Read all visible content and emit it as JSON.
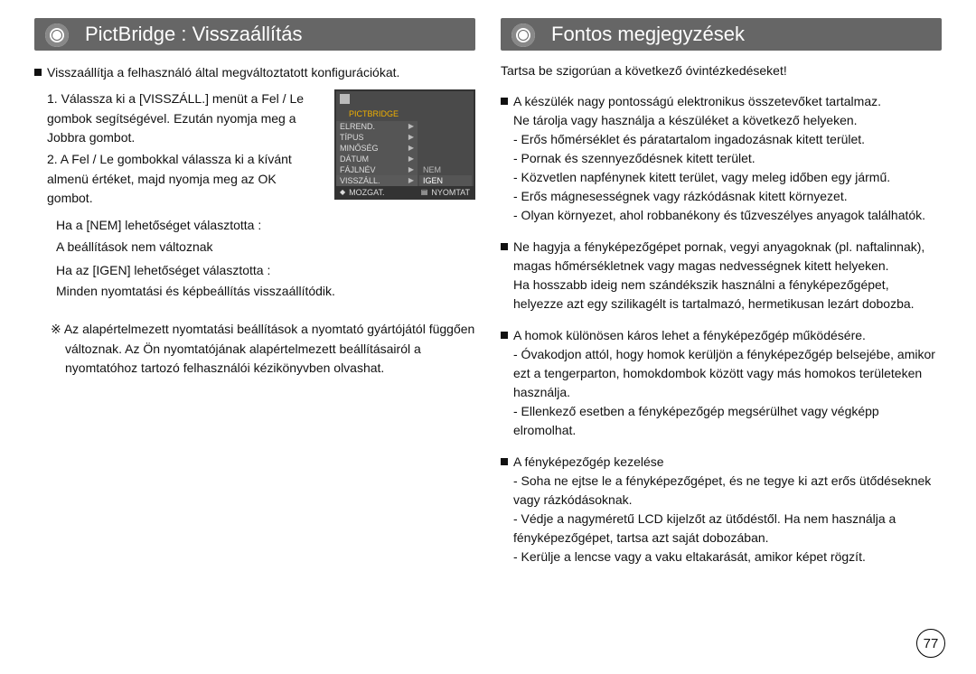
{
  "left": {
    "header": "PictBridge : Visszaállítás",
    "intro": "Visszaállítja a felhasználó által megváltoztatott konfigurációkat.",
    "step1": "1. Válassza ki a [VISSZÁLL.] menüt a Fel / Le gombok segítségével. Ezután nyomja meg a Jobbra gombot.",
    "step2": "2. A Fel / Le gombokkal válassza ki a kívánt almenü értéket, majd nyomja meg az OK gombot.",
    "cond_no_1": "Ha a [NEM] lehetőséget választotta :",
    "cond_no_2": "A beállítások nem változnak",
    "cond_yes_1": "Ha az [IGEN] lehetőséget választotta :",
    "cond_yes_2": "Minden nyomtatási és képbeállítás visszaállítódik.",
    "footnote": "※ Az alapértelmezett nyomtatási beállítások a nyomtató gyártójától függően változnak. Az Ön nyomtatójának alapértelmezett beállításairól a nyomtatóhoz tartozó felhasználói kézikönyvben olvashat.",
    "lcd": {
      "header": "PICTBRIDGE",
      "rows": [
        "ELREND.",
        "TÍPUS",
        "MINŐSÉG",
        "DÁTUM",
        "FÁJLNÉV",
        "VISSZÁLL."
      ],
      "right_a": "NEM",
      "right_b": "IGEN",
      "bottom_left": "MOZGAT.",
      "bottom_right": "NYOMTAT"
    }
  },
  "right": {
    "header": "Fontos megjegyzések",
    "intro": "Tartsa be szigorúan a következő óvintézkedéseket!",
    "blocks": [
      {
        "lead": "A készülék nagy pontosságú elektronikus összetevőket tartalmaz.",
        "cont": "Ne tárolja vagy használja a készüléket a következő helyeken.",
        "subs": [
          "- Erős hőmérséklet és páratartalom ingadozásnak kitett terület.",
          "- Pornak és szennyeződésnek kitett terület.",
          "- Közvetlen napfénynek kitett terület, vagy meleg időben egy jármű.",
          "- Erős mágnesességnek vagy rázkódásnak kitett környezet.",
          "- Olyan környezet, ahol robbanékony és tűzveszélyes anyagok találhatók."
        ]
      },
      {
        "lead": "Ne hagyja a fényképezőgépet pornak, vegyi anyagoknak (pl. naftalinnak), magas hőmérsékletnek vagy magas nedvességnek kitett helyeken.",
        "cont": "Ha hosszabb ideig nem szándékszik használni a fényképezőgépet, helyezze azt egy szilikagélt is tartalmazó, hermetikusan lezárt dobozba.",
        "subs": []
      },
      {
        "lead": "A homok különösen káros lehet a fényképezőgép működésére.",
        "cont": "",
        "subs": [
          "- Óvakodjon attól, hogy homok kerüljön a fényképezőgép belsejébe, amikor ezt a tengerparton, homokdombok között vagy más homokos területeken használja.",
          "- Ellenkező esetben a fényképezőgép megsérülhet vagy végképp elromolhat."
        ]
      },
      {
        "lead": "A fényképezőgép kezelése",
        "cont": "",
        "subs": [
          "- Soha ne ejtse le a fényképezőgépet, és ne tegye ki azt erős ütődéseknek vagy rázkódásoknak.",
          "- Védje a nagyméretű LCD kijelzőt az ütődéstől. Ha nem használja a fényképezőgépet, tartsa azt saját dobozában.",
          "- Kerülje a lencse vagy a vaku eltakarását, amikor képet rögzít."
        ]
      }
    ]
  },
  "page_number": "77"
}
